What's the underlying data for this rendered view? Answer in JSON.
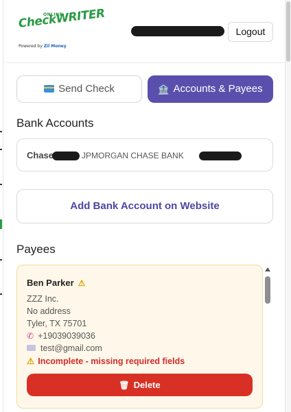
{
  "header": {
    "logo": {
      "online": "ONLINE",
      "brand": "CheckWRITER",
      "powered_by": "Powered by",
      "powered_brand": "Zil Money"
    },
    "logout_label": "Logout"
  },
  "tabs": [
    {
      "label": "Send Check",
      "icon": "credit-card-icon",
      "active": false
    },
    {
      "label": "Accounts & Payees",
      "icon": "bank-icon",
      "active": true
    }
  ],
  "bank_accounts": {
    "heading": "Bank Accounts",
    "items": [
      {
        "name": "Chase",
        "bank": "JPMORGAN CHASE BANK"
      }
    ],
    "add_label": "Add Bank Account on Website"
  },
  "payees": {
    "heading": "Payees",
    "items": [
      {
        "name": "Ben Parker",
        "company": "ZZZ Inc.",
        "address": "No address",
        "city": "Tyler, TX 75701",
        "phone": "+19039039036",
        "email": "test@gmail.com",
        "status": "Incomplete - missing required fields",
        "delete_label": "Delete"
      }
    ]
  },
  "colors": {
    "accent": "#5b4fad",
    "danger": "#d93025",
    "warning_bg": "#fff8ea",
    "brand_green": "#2a9a44"
  }
}
